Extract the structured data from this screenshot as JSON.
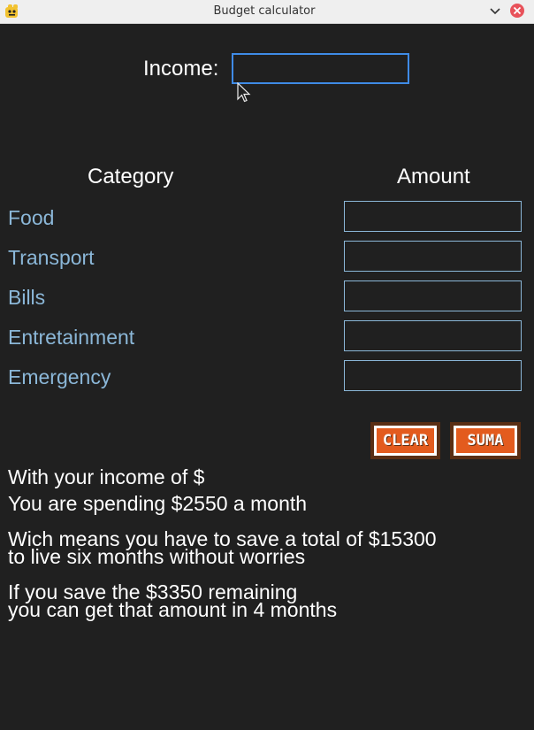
{
  "window": {
    "title": "Budget calculator"
  },
  "income": {
    "label": "Income:",
    "value": ""
  },
  "table": {
    "category_header": "Category",
    "amount_header": "Amount",
    "rows": [
      {
        "category": "Food",
        "amount": ""
      },
      {
        "category": "Transport",
        "amount": ""
      },
      {
        "category": "Bills",
        "amount": ""
      },
      {
        "category": "Entretainment",
        "amount": ""
      },
      {
        "category": "Emergency",
        "amount": ""
      }
    ]
  },
  "buttons": {
    "clear_label": "CLEAR",
    "suma_label": "SUMA"
  },
  "results": {
    "line1": "With your income of $",
    "line2": "You are spending $2550 a month",
    "line3a": "Wich means you have to save a total of $15300",
    "line3b": "to live six months without worries",
    "line4a": "If you save the $3350 remaining",
    "line4b": "you can get that amount in 4 months"
  },
  "colors": {
    "background": "#202020",
    "category_text": "#8bb7d8",
    "button_fill": "#e35b1e",
    "focus_border": "#3f8be6"
  }
}
